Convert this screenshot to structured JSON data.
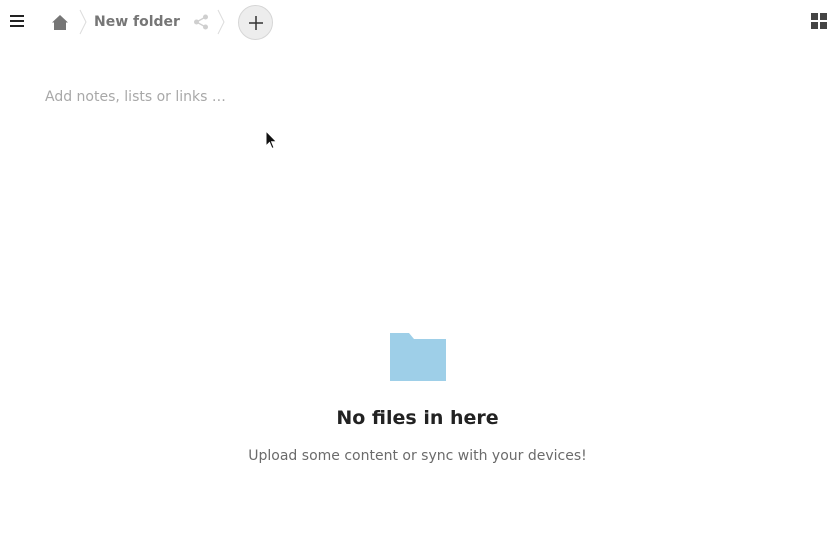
{
  "header": {
    "menu_icon": "hamburger-menu-icon",
    "breadcrumb": {
      "home_icon": "home-icon",
      "current_folder": "New folder",
      "share_icon": "share-icon"
    },
    "add_icon": "plus-icon",
    "view_toggle_icon": "grid-view-icon"
  },
  "workspace": {
    "placeholder": "Add notes, lists or links …"
  },
  "empty_content": {
    "icon": "folder-icon",
    "title": "No files in here",
    "description": "Upload some content or sync with your devices!"
  },
  "colors": {
    "folder": "#9ecfe8",
    "icon_gray": "#767676",
    "text_dark": "#222222",
    "text_muted": "#6b6b6b",
    "placeholder": "#a8a8a8",
    "add_button_bg": "#ededed"
  }
}
